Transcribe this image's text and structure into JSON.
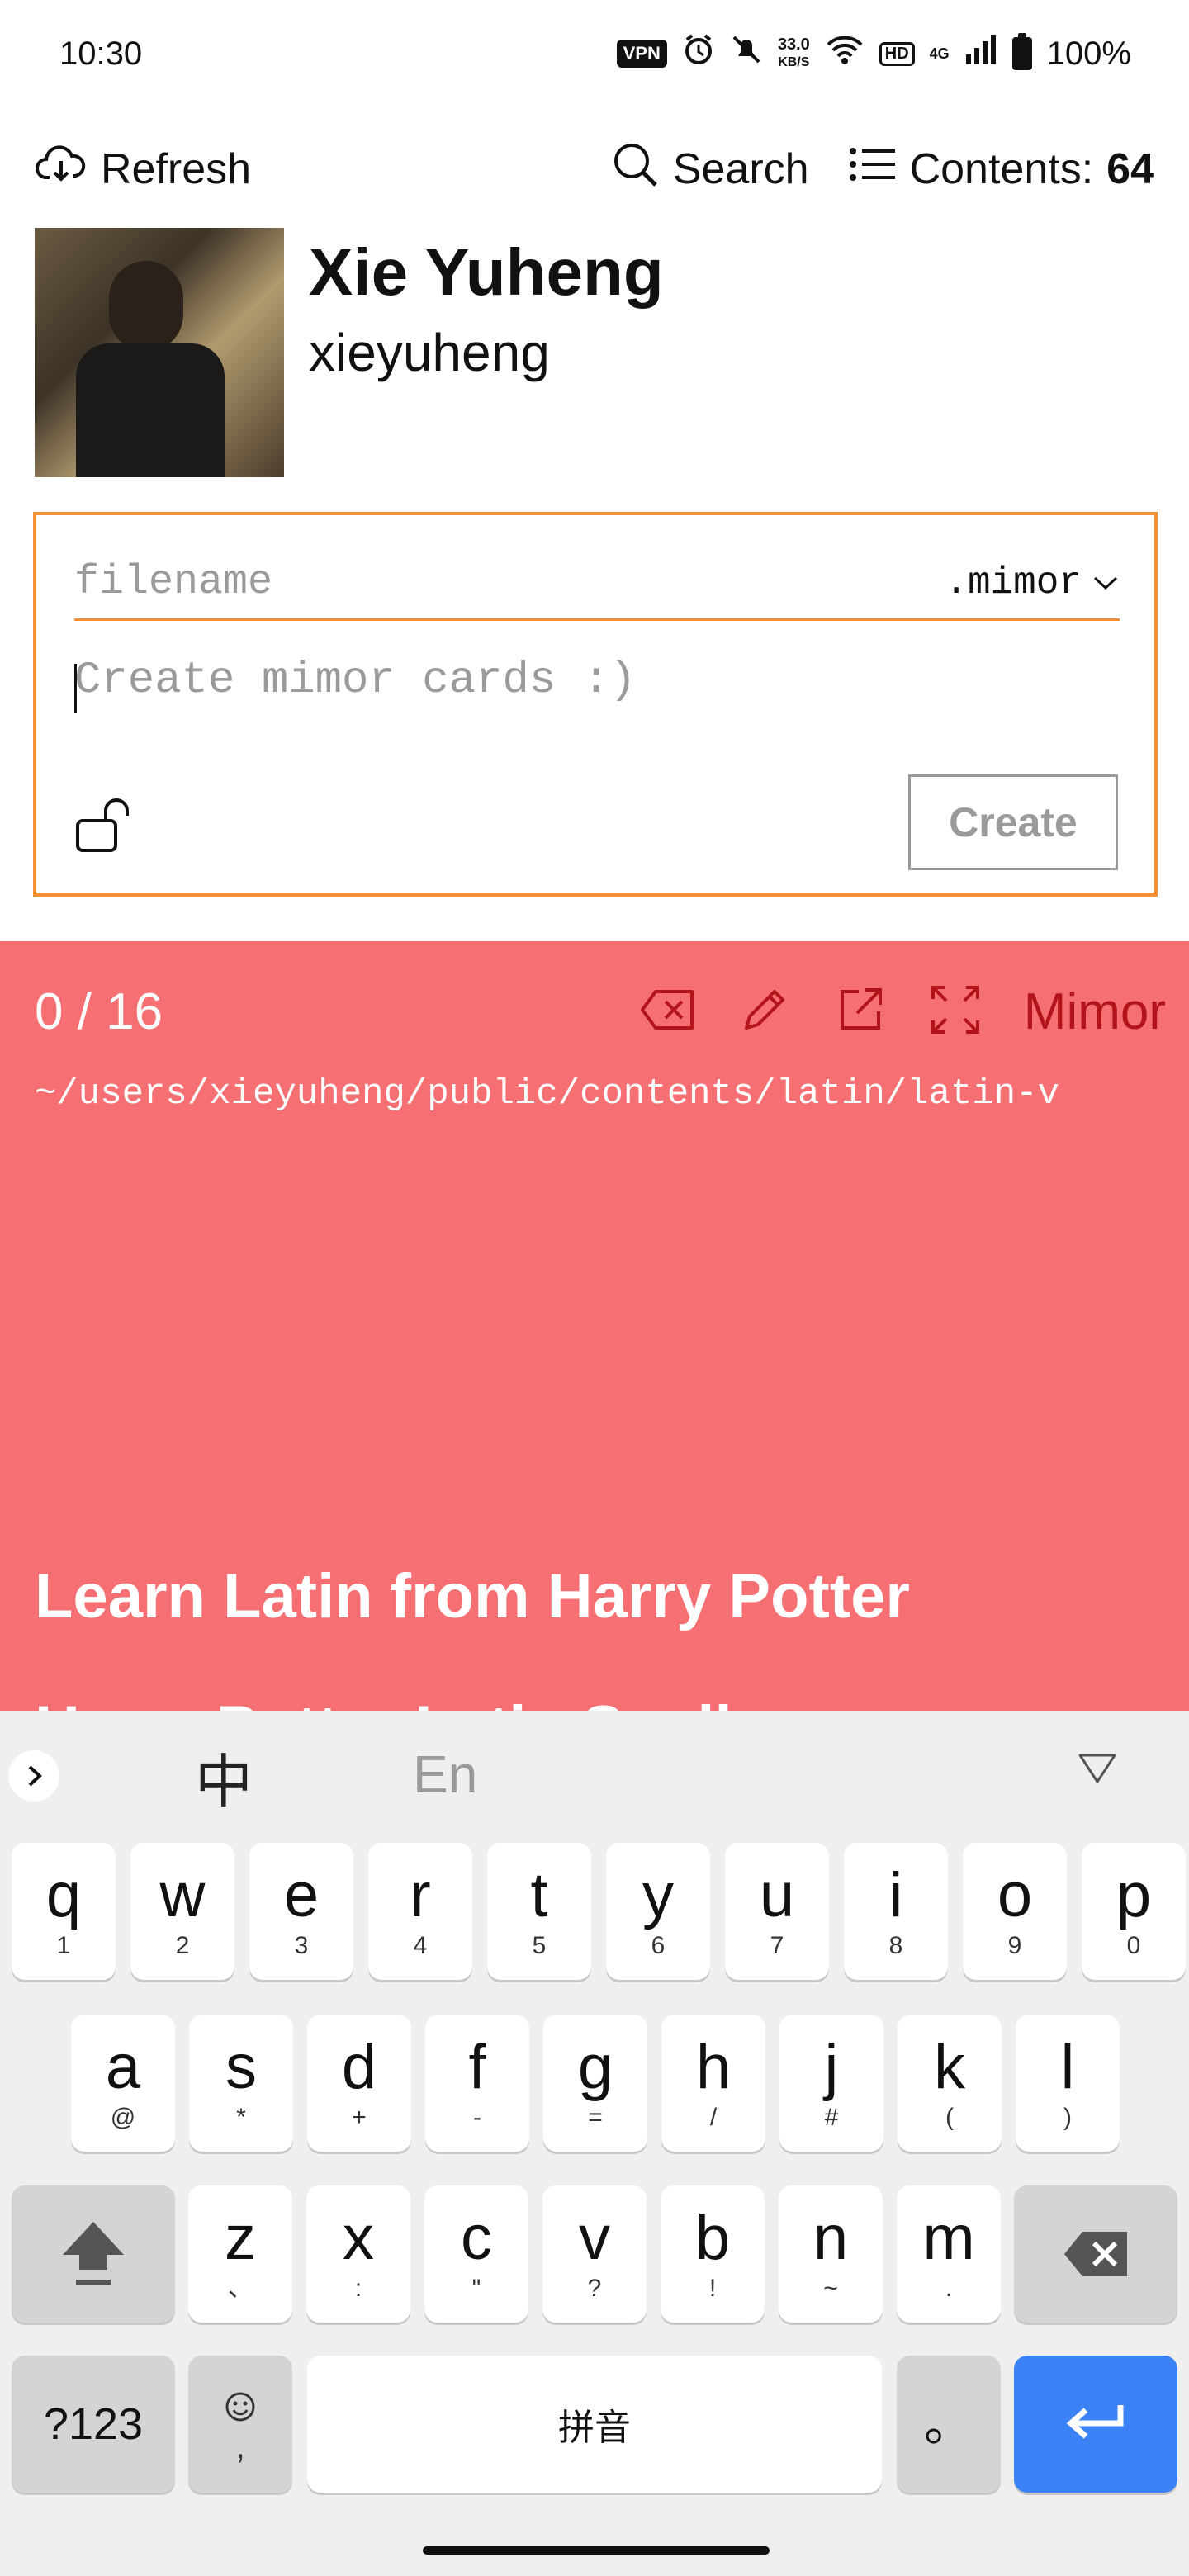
{
  "status_bar": {
    "time": "10:30",
    "vpn": "VPN",
    "net_speed_value": "33.0",
    "net_speed_unit": "KB/S",
    "hd": "HD",
    "signal": "4G",
    "battery": "100%"
  },
  "nav": {
    "refresh_label": "Refresh",
    "search_label": "Search",
    "contents_label": "Contents:",
    "contents_count": "64"
  },
  "profile": {
    "name": "Xie Yuheng",
    "username": "xieyuheng"
  },
  "editor": {
    "filename_placeholder": "filename",
    "extension": ".mimor",
    "cards_placeholder": "Create mimor cards :)",
    "create_label": "Create"
  },
  "panel": {
    "pager": "0 / 16",
    "mimor_label": "Mimor",
    "path": "~/users/xieyuheng/public/contents/latin/latin-v",
    "title": "Learn Latin from Harry Potter",
    "subtitle": "Harry Potter Latin Spells",
    "background_color": "#f66f72",
    "accent_color": "#b3141b"
  },
  "keyboard": {
    "chinese_toggle": "中",
    "english_toggle": "En",
    "row1": [
      {
        "key": "q",
        "sub": "1"
      },
      {
        "key": "w",
        "sub": "2"
      },
      {
        "key": "e",
        "sub": "3"
      },
      {
        "key": "r",
        "sub": "4"
      },
      {
        "key": "t",
        "sub": "5"
      },
      {
        "key": "y",
        "sub": "6"
      },
      {
        "key": "u",
        "sub": "7"
      },
      {
        "key": "i",
        "sub": "8"
      },
      {
        "key": "o",
        "sub": "9"
      },
      {
        "key": "p",
        "sub": "0"
      }
    ],
    "row2": [
      {
        "key": "a",
        "sub": "@"
      },
      {
        "key": "s",
        "sub": "*"
      },
      {
        "key": "d",
        "sub": "+"
      },
      {
        "key": "f",
        "sub": "-"
      },
      {
        "key": "g",
        "sub": "="
      },
      {
        "key": "h",
        "sub": "/"
      },
      {
        "key": "j",
        "sub": "#"
      },
      {
        "key": "k",
        "sub": "("
      },
      {
        "key": "l",
        "sub": ")"
      }
    ],
    "row3": [
      {
        "key": "z",
        "sub": "、"
      },
      {
        "key": "x",
        "sub": ":"
      },
      {
        "key": "c",
        "sub": "\""
      },
      {
        "key": "v",
        "sub": "?"
      },
      {
        "key": "b",
        "sub": "!"
      },
      {
        "key": "n",
        "sub": "~"
      },
      {
        "key": "m",
        "sub": "."
      }
    ],
    "symbols_label": "?123",
    "emoji_sub": ",",
    "space_label": "拼音",
    "period_label": "。",
    "enter_color": "#3b82f6"
  }
}
